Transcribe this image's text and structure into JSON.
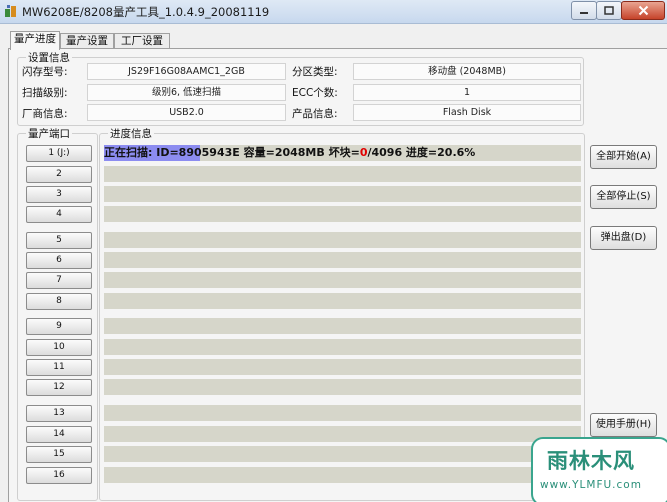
{
  "window": {
    "title": "MW6208E/8208量产工具_1.0.4.9_20081119",
    "controls": {
      "minimize_icon": "minimize-icon",
      "maximize_icon": "maximize-icon",
      "close_icon": "close-icon"
    }
  },
  "tabs": [
    {
      "label": "量产进度",
      "active": true
    },
    {
      "label": "量产设置",
      "active": false
    },
    {
      "label": "工厂设置",
      "active": false
    }
  ],
  "settings": {
    "group_title": "设置信息",
    "rows": [
      {
        "left_label": "闪存型号:",
        "left_value": "JS29F16G08AAMC1_2GB",
        "right_label": "分区类型:",
        "right_value": "移动盘 (2048MB)"
      },
      {
        "left_label": "扫描级别:",
        "left_value": "级别6, 低速扫描",
        "right_label": "ECC个数:",
        "right_value": "1"
      },
      {
        "left_label": "厂商信息:",
        "left_value": "USB2.0",
        "right_label": "产品信息:",
        "right_value": "Flash Disk"
      }
    ]
  },
  "ports": {
    "group_title": "量产端口",
    "items": [
      "1 (J:)",
      "2",
      "3",
      "4",
      "5",
      "6",
      "7",
      "8",
      "9",
      "10",
      "11",
      "12",
      "13",
      "14",
      "15",
      "16"
    ]
  },
  "progress": {
    "group_title": "进度信息",
    "status": {
      "prefix": "正在扫描:",
      "middle": " ID=8905943E 容量=2048MB 坏块=",
      "bad_blocks": "0",
      "suffix": "/4096 进度=20.6%"
    },
    "percent": 20.6,
    "highlight_color": "#8c8cf0",
    "bad_block_color": "#e00000"
  },
  "buttons": {
    "start_all": "全部开始(A)",
    "stop_all": "全部停止(S)",
    "eject": "弹出盘(D)",
    "manual": "使用手册(H)"
  },
  "watermark": {
    "main": "雨林木风",
    "url": "www.YLMFU.com"
  }
}
